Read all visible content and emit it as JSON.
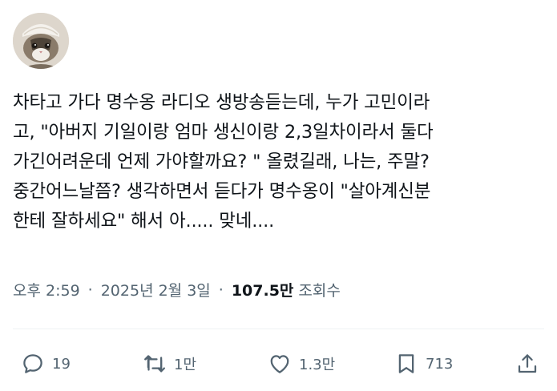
{
  "post": {
    "avatar_icon": "cat-avatar",
    "lines": [
      "차타고 가다 명수옹 라디오 생방송듣는데, 누가 고민이라",
      "고, \"아버지 기일이랑 엄마 생신이랑 2,3일차이라서 둘다",
      "가긴어려운데 언제 가야할까요? \" 올렸길래, 나는, 주말?",
      "중간어느날쯤?  생각하면서 듣다가 명수옹이 \"살아계신분",
      "한테 잘하세요\" 해서 아..... 맞네...."
    ]
  },
  "meta": {
    "time": "오후 2:59",
    "separator": "·",
    "date": "2025년 2월 3일",
    "views_count": "107.5만",
    "views_label": "조회수"
  },
  "actions": {
    "reply": {
      "icon": "reply-icon",
      "count": "19"
    },
    "retweet": {
      "icon": "retweet-icon",
      "count": "1만"
    },
    "like": {
      "icon": "heart-icon",
      "count": "1.3만"
    },
    "bookmark": {
      "icon": "bookmark-icon",
      "count": "713"
    },
    "share": {
      "icon": "share-icon"
    }
  },
  "colors": {
    "text": "#0f1419",
    "secondary": "#536471",
    "divider": "#eff3f4"
  }
}
